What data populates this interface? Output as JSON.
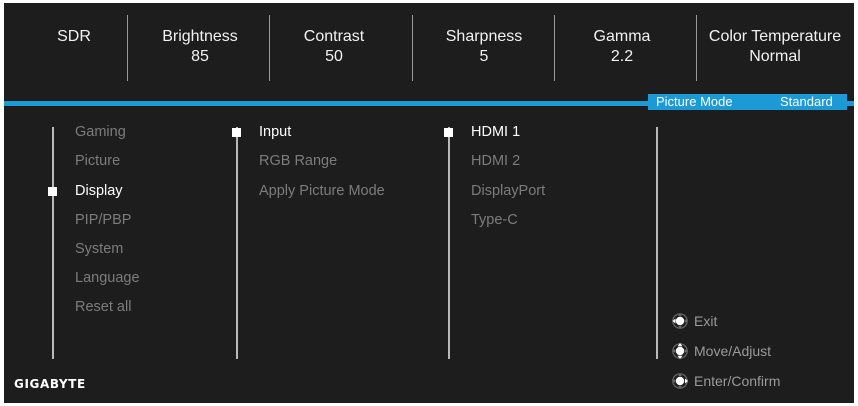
{
  "status_bar": {
    "sdr": "SDR",
    "brightness": {
      "label": "Brightness",
      "value": "85"
    },
    "contrast": {
      "label": "Contrast",
      "value": "50"
    },
    "sharpness": {
      "label": "Sharpness",
      "value": "5"
    },
    "gamma": {
      "label": "Gamma",
      "value": "2.2"
    },
    "color_temperature": {
      "label": "Color Temperature",
      "value": "Normal"
    }
  },
  "picture_mode": {
    "label": "Picture Mode",
    "value": "Standard"
  },
  "menu": {
    "main": [
      "Gaming",
      "Picture",
      "Display",
      "PIP/PBP",
      "System",
      "Language",
      "Reset all"
    ],
    "main_selected": "Display",
    "sub": [
      "Input",
      "RGB Range",
      "Apply Picture Mode"
    ],
    "sub_selected": "Input",
    "options": [
      "HDMI 1",
      "HDMI 2",
      "DisplayPort",
      "Type-C"
    ],
    "options_selected": "HDMI 1"
  },
  "hints": {
    "exit": "Exit",
    "move_adjust": "Move/Adjust",
    "enter_confirm": "Enter/Confirm"
  },
  "brand": "GIGABYTE",
  "colors": {
    "background": "#1d1d1d",
    "accent": "#1c9ad6",
    "active_text": "#ffffff",
    "inactive_text": "#7c7c7c"
  }
}
